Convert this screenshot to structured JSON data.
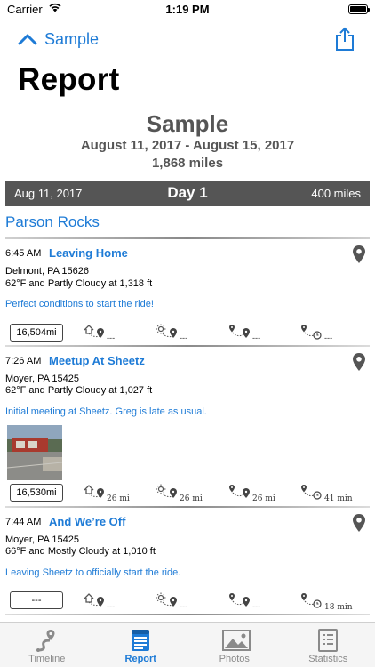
{
  "status": {
    "carrier": "Carrier",
    "time": "1:19 PM"
  },
  "nav": {
    "back_label": "Sample",
    "title": "Report"
  },
  "report": {
    "name": "Sample",
    "dates": "August 11, 2017 - August 15, 2017",
    "miles": "1,868 miles"
  },
  "day": {
    "date": "Aug 11, 2017",
    "label": "Day 1",
    "miles": "400 miles"
  },
  "section": {
    "title": "Parson Rocks"
  },
  "entries": [
    {
      "time": "6:45 AM",
      "title": "Leaving Home",
      "address": "Delmont, PA 15626",
      "weather": "62°F and Partly Cloudy at 1,318 ft",
      "note": "Perfect conditions to start the ride!",
      "odometer": "16,504mi",
      "stats": [
        "---",
        "---",
        "---",
        "---"
      ]
    },
    {
      "time": "7:26 AM",
      "title": "Meetup At Sheetz",
      "address": "Moyer, PA 15425",
      "weather": "62°F and Partly Cloudy at 1,027 ft",
      "note": "Initial meeting at Sheetz. Greg is late as usual.",
      "odometer": "16,530mi",
      "stats": [
        "26 mi",
        "26 mi",
        "26 mi",
        "41 min"
      ]
    },
    {
      "time": "7:44 AM",
      "title": "And We’re Off",
      "address": "Moyer, PA 15425",
      "weather": "66°F and Mostly Cloudy at 1,010 ft",
      "note": "Leaving Sheetz to officially start the ride.",
      "odometer": "---",
      "stats": [
        "---",
        "---",
        "---",
        "18 min"
      ]
    }
  ],
  "tabs": [
    {
      "label": "Timeline",
      "icon": "timeline-icon",
      "active": false
    },
    {
      "label": "Report",
      "icon": "report-icon",
      "active": true
    },
    {
      "label": "Photos",
      "icon": "photos-icon",
      "active": false
    },
    {
      "label": "Statistics",
      "icon": "statistics-icon",
      "active": false
    }
  ],
  "colors": {
    "accent": "#1e7bd6",
    "day_bar": "#555555"
  }
}
